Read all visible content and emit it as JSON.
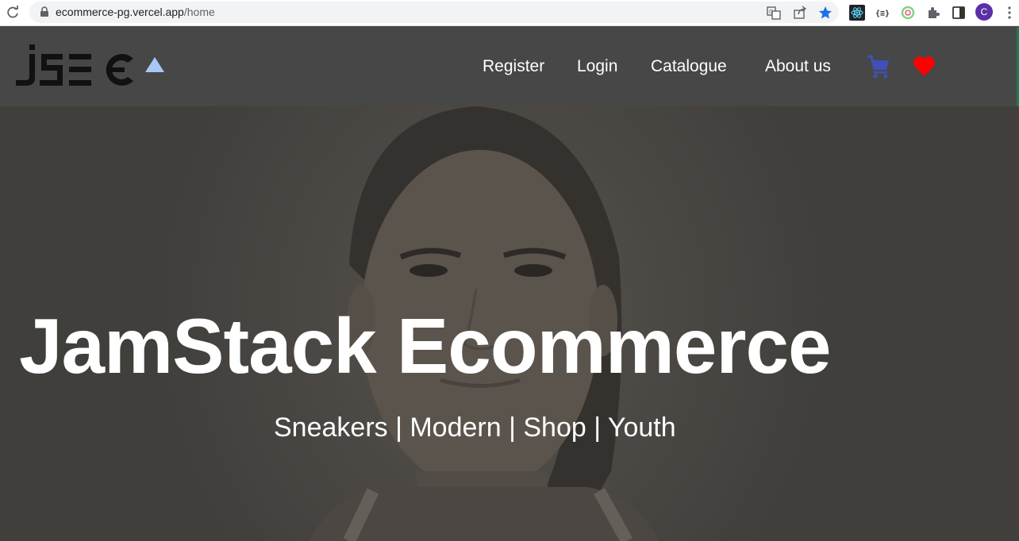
{
  "browser": {
    "url_host": "ecommerce-pg.vercel.app",
    "url_path": "/home",
    "profile_initial": "C",
    "icons": [
      "reload-icon",
      "lock-icon",
      "translate-icon",
      "share-icon",
      "bookmark-star-icon",
      "react-devtools-icon",
      "json-formatter-icon",
      "extension-ring-icon",
      "extensions-puzzle-icon",
      "side-panel-icon",
      "more-menu-icon"
    ],
    "colors": {
      "star": "#1a73e8",
      "profile": "#5b2fa8"
    }
  },
  "header": {
    "logo_text": "jSEC",
    "nav": {
      "register": "Register",
      "login": "Login",
      "catalogue": "Catalogue",
      "about": "About us"
    },
    "colors": {
      "background": "#474747",
      "cart": "#3f51b5",
      "heart": "#ff0000",
      "logo_triangle": "#a9c7f5"
    }
  },
  "hero": {
    "title": "JamStack Ecommerce",
    "tagline": "Sneakers | Modern | Shop | Youth"
  }
}
